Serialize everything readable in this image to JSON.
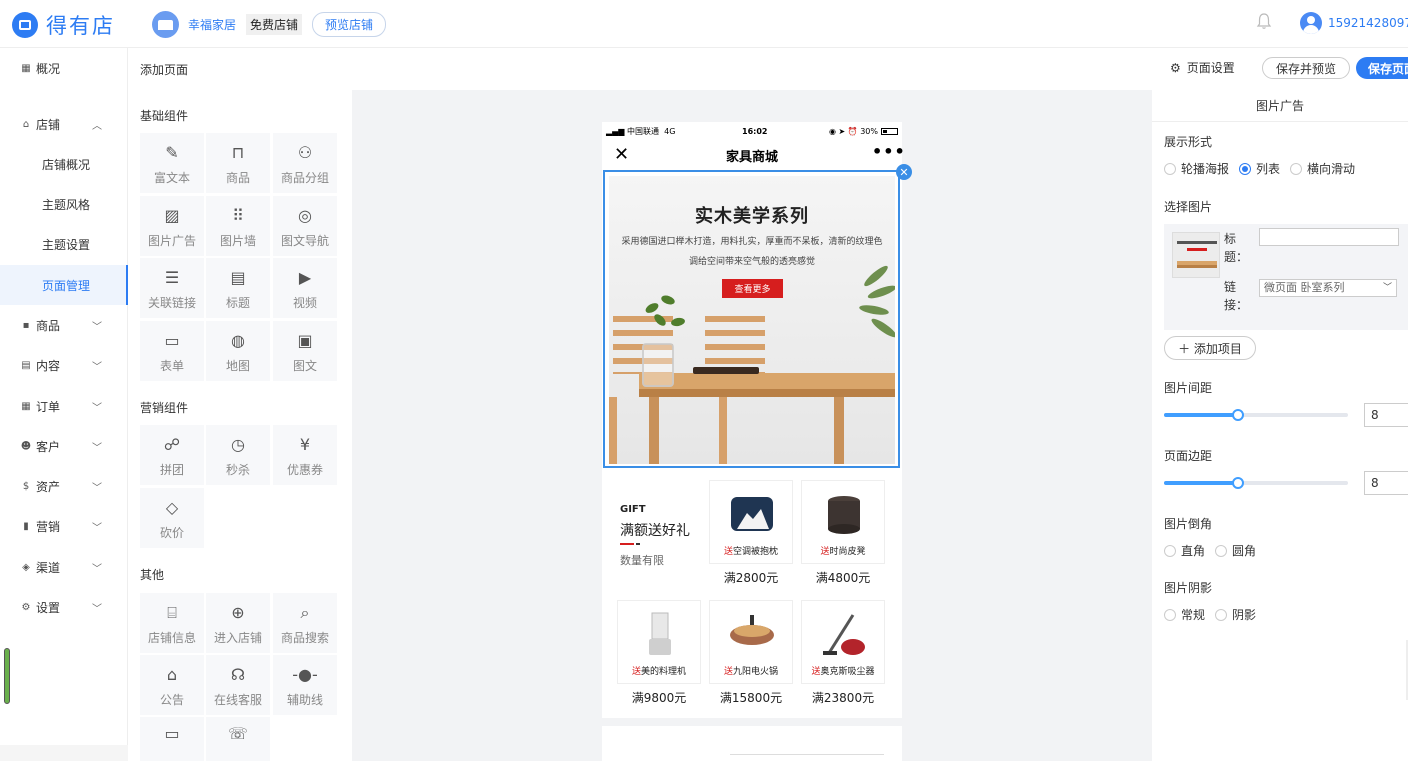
{
  "header": {
    "brand": "得有店",
    "shop_name": "幸福家居",
    "shop_tag": "免费店铺",
    "preview_shop": "预览店铺",
    "user_phone": "15921428097"
  },
  "sidebar": {
    "items": [
      {
        "label": "概况",
        "icon": "grid-icon"
      },
      {
        "label": "店铺",
        "icon": "shop-icon",
        "expanded": true
      },
      {
        "label": "商品",
        "icon": "goods-icon"
      },
      {
        "label": "内容",
        "icon": "content-icon"
      },
      {
        "label": "订单",
        "icon": "order-icon"
      },
      {
        "label": "客户",
        "icon": "customer-icon"
      },
      {
        "label": "资产",
        "icon": "asset-icon"
      },
      {
        "label": "营销",
        "icon": "marketing-icon"
      },
      {
        "label": "渠道",
        "icon": "channel-icon"
      },
      {
        "label": "设置",
        "icon": "settings-icon"
      }
    ],
    "shop_sub": [
      "店铺概况",
      "主题风格",
      "主题设置",
      "页面管理"
    ],
    "active_sub": "页面管理"
  },
  "subheader": {
    "title": "添加页面",
    "page_settings": "页面设置",
    "save_preview": "保存并预览",
    "save": "保存页面"
  },
  "components": {
    "basic_title": "基础组件",
    "basic": [
      "富文本",
      "商品",
      "商品分组",
      "图片广告",
      "图片墙",
      "图文导航",
      "关联链接",
      "标题",
      "视频",
      "表单",
      "地图",
      "图文"
    ],
    "marketing_title": "营销组件",
    "marketing": [
      "拼团",
      "秒杀",
      "优惠券",
      "砍价"
    ],
    "other_title": "其他",
    "other": [
      "店铺信息",
      "进入店铺",
      "商品搜索",
      "公告",
      "在线客服",
      "辅助线"
    ]
  },
  "phone": {
    "carrier": "中国联通",
    "network": "4G",
    "time": "16:02",
    "battery": "30%",
    "battery_level": 0.3,
    "title": "家具商城",
    "banner": {
      "title": "实木美学系列",
      "desc": "采用德国进口榉木打造，用料扎实，厚重而不呆板，清新的纹理色调给空间带来空气般的透亮感觉",
      "button": "查看更多"
    },
    "gift": {
      "label": "GIFT",
      "title": "满额送好礼",
      "sub": "数量有限"
    },
    "products": [
      {
        "prefix": "送",
        "name": "空调被抱枕",
        "price": "满2800元"
      },
      {
        "prefix": "送",
        "name": "时尚皮凳",
        "price": "满4800元"
      },
      {
        "prefix": "送",
        "name": "美的料理机",
        "price": "满9800元"
      },
      {
        "prefix": "送",
        "name": "九阳电火锅",
        "price": "满15800元"
      },
      {
        "prefix": "送",
        "name": "奥克斯吸尘器",
        "price": "满23800元"
      }
    ]
  },
  "props": {
    "title": "图片广告",
    "display_label": "展示形式",
    "display_options": [
      "轮播海报",
      "列表",
      "横向滑动"
    ],
    "display_selected": "列表",
    "select_image_label": "选择图片",
    "item_title_label": "标题：",
    "item_title_value": "",
    "item_link_label": "链接：",
    "item_link_value": "微页面 卧室系列",
    "add_item": "添加项目",
    "spacing_label": "图片间距",
    "spacing_value": "8",
    "spacing_level": 0.4,
    "margin_label": "页面边距",
    "margin_value": "8",
    "margin_level": 0.4,
    "corner_label": "图片倒角",
    "corner_options": [
      "直角",
      "圆角"
    ],
    "shadow_label": "图片阴影",
    "shadow_options": [
      "常规",
      "阴影"
    ]
  }
}
